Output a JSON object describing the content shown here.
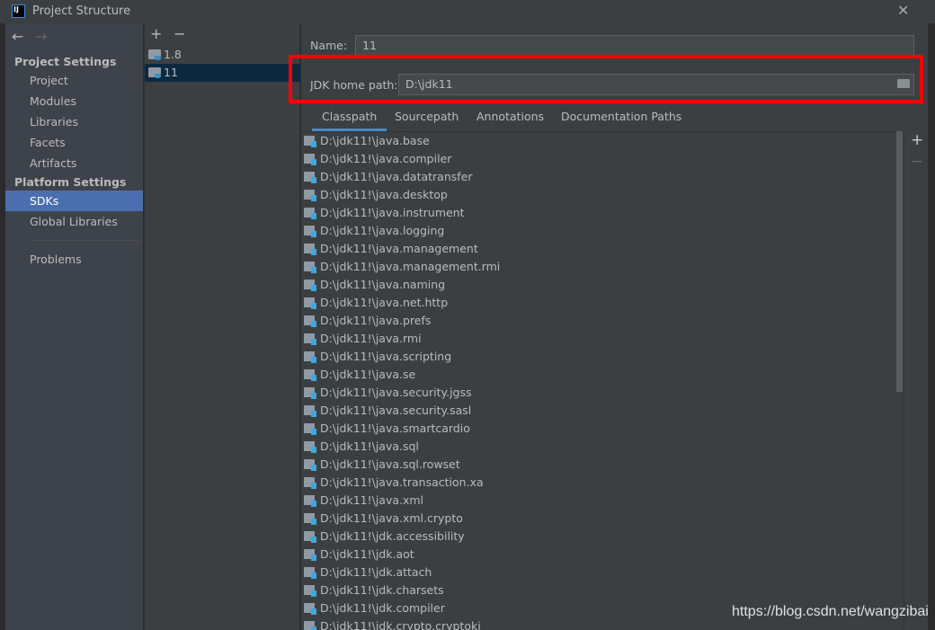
{
  "window": {
    "title": "Project Structure",
    "app_icon": "IJ",
    "close": "✕"
  },
  "sidebar": {
    "back": "←",
    "forward": "→",
    "project_settings": "Project Settings",
    "project_items": [
      "Project",
      "Modules",
      "Libraries",
      "Facets",
      "Artifacts"
    ],
    "platform_settings": "Platform Settings",
    "platform_items": [
      "SDKs",
      "Global Libraries"
    ],
    "problems": "Problems",
    "selected": "SDKs"
  },
  "sdk_list": {
    "add": "+",
    "remove": "−",
    "items": [
      "1.8",
      "11"
    ],
    "selected": "11"
  },
  "main": {
    "name_label": "Name:",
    "name_value": "11",
    "jdk_label": "JDK home path:",
    "jdk_value": "D:\\jdk11",
    "tabs": [
      "Classpath",
      "Sourcepath",
      "Annotations",
      "Documentation Paths"
    ],
    "active_tab": "Classpath",
    "classpath": [
      "D:\\jdk11!\\java.base",
      "D:\\jdk11!\\java.compiler",
      "D:\\jdk11!\\java.datatransfer",
      "D:\\jdk11!\\java.desktop",
      "D:\\jdk11!\\java.instrument",
      "D:\\jdk11!\\java.logging",
      "D:\\jdk11!\\java.management",
      "D:\\jdk11!\\java.management.rmi",
      "D:\\jdk11!\\java.naming",
      "D:\\jdk11!\\java.net.http",
      "D:\\jdk11!\\java.prefs",
      "D:\\jdk11!\\java.rmi",
      "D:\\jdk11!\\java.scripting",
      "D:\\jdk11!\\java.se",
      "D:\\jdk11!\\java.security.jgss",
      "D:\\jdk11!\\java.security.sasl",
      "D:\\jdk11!\\java.smartcardio",
      "D:\\jdk11!\\java.sql",
      "D:\\jdk11!\\java.sql.rowset",
      "D:\\jdk11!\\java.transaction.xa",
      "D:\\jdk11!\\java.xml",
      "D:\\jdk11!\\java.xml.crypto",
      "D:\\jdk11!\\jdk.accessibility",
      "D:\\jdk11!\\jdk.aot",
      "D:\\jdk11!\\jdk.attach",
      "D:\\jdk11!\\jdk.charsets",
      "D:\\jdk11!\\jdk.compiler",
      "D:\\jdk11!\\jdk.crypto.cryptoki"
    ],
    "add": "+",
    "remove": "−"
  },
  "watermark": "https://blog.csdn.net/wangzibai",
  "colors": {
    "highlight_box": "#ff0000",
    "selection": "#4b6eaf",
    "sdk_selection": "#0d293e"
  }
}
